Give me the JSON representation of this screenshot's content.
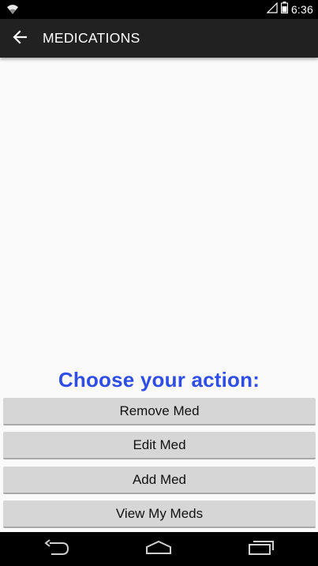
{
  "status_bar": {
    "time": "6:36",
    "icons": [
      "wifi-icon",
      "signal-icon",
      "battery-icon"
    ]
  },
  "app_bar": {
    "back_icon": "arrow-left-icon",
    "title": "MEDICATIONS"
  },
  "main": {
    "heading": "Choose your action:",
    "heading_color": "#2f4ee6",
    "buttons": [
      {
        "label": "Remove Med"
      },
      {
        "label": "Edit Med"
      },
      {
        "label": "Add Med"
      },
      {
        "label": "View My Meds"
      }
    ]
  },
  "nav_bar": {
    "icons": [
      "back-nav-icon",
      "home-nav-icon",
      "recents-nav-icon"
    ]
  },
  "colors": {
    "app_bar": "#212121",
    "button_bg": "#d6d6d6",
    "background": "#fafafa"
  }
}
